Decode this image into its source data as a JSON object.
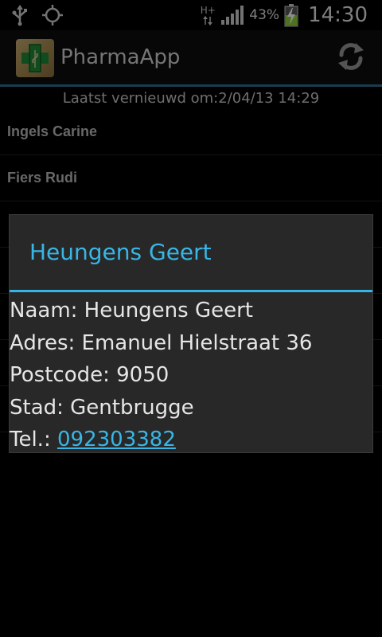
{
  "status_bar": {
    "icons": [
      "usb-icon",
      "gps-icon",
      "network-hplus-icon",
      "signal-icon",
      "battery-charging-icon"
    ],
    "network_label": "H+",
    "battery_percent": "43%",
    "time": "14:30"
  },
  "app": {
    "title": "PharmaApp",
    "logo_icon": "pharmacy-cross-icon",
    "refresh_icon": "refresh-icon",
    "accent_color": "#33b5e5"
  },
  "list": {
    "last_updated": "Laatst vernieuwd om:2/04/13 14:29",
    "items": [
      {
        "label": "Ingels Carine"
      },
      {
        "label": "Fiers Rudi"
      }
    ]
  },
  "dialog": {
    "title": "Heungens Geert",
    "name_line": "Naam: Heungens Geert",
    "address_line": "Adres: Emanuel Hielstraat 36",
    "postcode_line": "Postcode: 9050",
    "city_line": "Stad: Gentbrugge",
    "tel_label": "Tel.: ",
    "tel_value": "092303382"
  }
}
